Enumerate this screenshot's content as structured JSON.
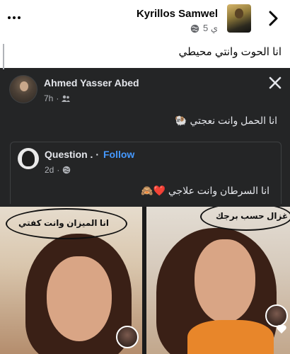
{
  "post": {
    "author": "Kyrillos Samwel",
    "time": "5 ي",
    "caption": "انا الحوت وانتي محيطي"
  },
  "shared": {
    "author": "Ahmed Yasser Abed",
    "time": "7h",
    "text": "انا الحمل وانت نعجتي",
    "emoji": "🐏"
  },
  "quoted": {
    "author": "Question .",
    "separator": "·",
    "follow_label": "Follow",
    "time": "2d",
    "text": "انا السرطان وانت علاجي",
    "emoji": "❤️🙈"
  },
  "photos": {
    "left_label": "انا الميزان وانت كفتي",
    "right_label": "غزال حسب برجك"
  },
  "icons": [
    "more-icon",
    "globe-icon",
    "back-icon",
    "friends-icon",
    "close-icon",
    "heart-icon"
  ],
  "colors": {
    "card_bg": "#242526",
    "link_blue": "#4599ff",
    "text_dark": "#050505",
    "muted": "#65676b"
  }
}
